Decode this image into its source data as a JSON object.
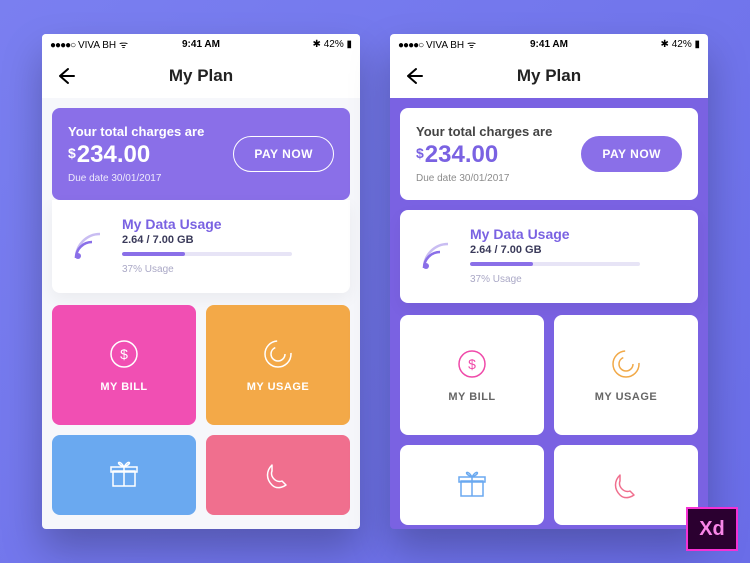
{
  "statusbar": {
    "carrier": "VIVA BH",
    "time": "9:41 AM",
    "battery": "42%"
  },
  "nav": {
    "title": "My Plan"
  },
  "charges": {
    "label": "Your total charges are",
    "currency": "$",
    "amount": "234.00",
    "due": "Due date 30/01/2017",
    "pay_label": "PAY NOW"
  },
  "usage": {
    "title": "My Data Usage",
    "used_total": "2.64 / 7.00 GB",
    "percent_label": "37% Usage",
    "percent": 37
  },
  "tiles": {
    "bill": "MY BILL",
    "usage": "MY USAGE"
  },
  "badge": "Xd"
}
